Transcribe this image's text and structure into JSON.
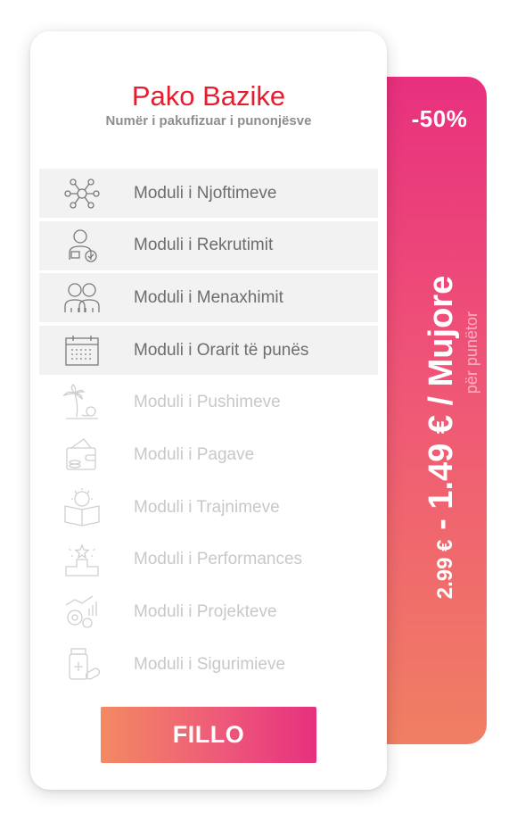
{
  "plan": {
    "title_light": "Pako",
    "title_bold": "Bazike",
    "subtitle": "Numër i pakufizuar i punonjësve"
  },
  "pricing": {
    "discount": "-50%",
    "old_price": "2.99 €",
    "separator": " - ",
    "new_price": "1.49 €",
    "period": " / Mujore",
    "unit": "për punëtor"
  },
  "modules": [
    {
      "label": "Moduli i Njoftimeve",
      "icon": "network-icon",
      "active": true
    },
    {
      "label": "Moduli i Rekrutimit",
      "icon": "recruit-icon",
      "active": true
    },
    {
      "label": "Moduli i Menaxhimit",
      "icon": "team-icon",
      "active": true
    },
    {
      "label": "Moduli i Orarit  të punës",
      "icon": "calendar-icon",
      "active": true
    },
    {
      "label": "Moduli i Pushimeve",
      "icon": "beach-icon",
      "active": false
    },
    {
      "label": "Moduli i Pagave",
      "icon": "wallet-icon",
      "active": false
    },
    {
      "label": "Moduli i Trajnimeve",
      "icon": "training-icon",
      "active": false
    },
    {
      "label": "Moduli i Performances",
      "icon": "podium-icon",
      "active": false
    },
    {
      "label": "Moduli i Projekteve",
      "icon": "project-icon",
      "active": false
    },
    {
      "label": "Moduli i Sigurimieve",
      "icon": "insurance-icon",
      "active": false
    }
  ],
  "cta": {
    "label": "FILLO"
  }
}
